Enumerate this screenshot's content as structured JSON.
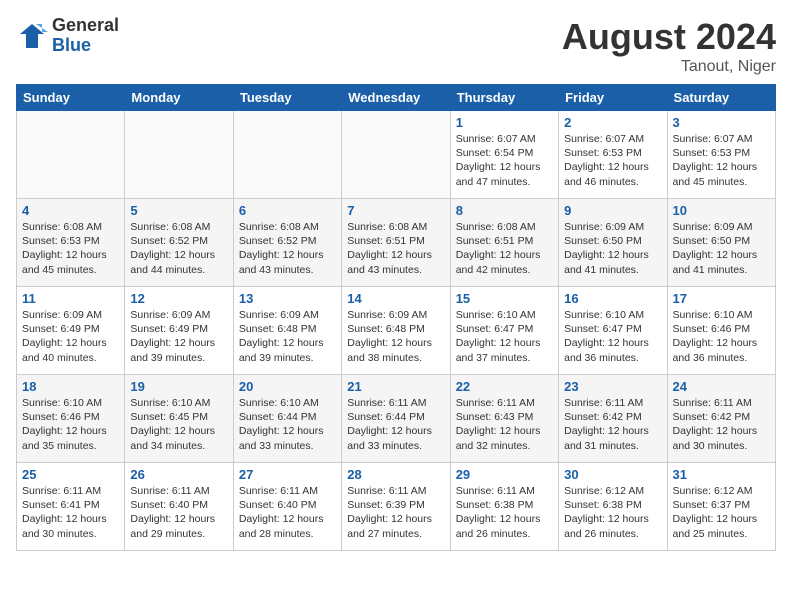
{
  "logo": {
    "general": "General",
    "blue": "Blue"
  },
  "title": {
    "month": "August 2024",
    "location": "Tanout, Niger"
  },
  "weekdays": [
    "Sunday",
    "Monday",
    "Tuesday",
    "Wednesday",
    "Thursday",
    "Friday",
    "Saturday"
  ],
  "weeks": [
    [
      {
        "day": "",
        "info": ""
      },
      {
        "day": "",
        "info": ""
      },
      {
        "day": "",
        "info": ""
      },
      {
        "day": "",
        "info": ""
      },
      {
        "day": "1",
        "info": "Sunrise: 6:07 AM\nSunset: 6:54 PM\nDaylight: 12 hours\nand 47 minutes."
      },
      {
        "day": "2",
        "info": "Sunrise: 6:07 AM\nSunset: 6:53 PM\nDaylight: 12 hours\nand 46 minutes."
      },
      {
        "day": "3",
        "info": "Sunrise: 6:07 AM\nSunset: 6:53 PM\nDaylight: 12 hours\nand 45 minutes."
      }
    ],
    [
      {
        "day": "4",
        "info": "Sunrise: 6:08 AM\nSunset: 6:53 PM\nDaylight: 12 hours\nand 45 minutes."
      },
      {
        "day": "5",
        "info": "Sunrise: 6:08 AM\nSunset: 6:52 PM\nDaylight: 12 hours\nand 44 minutes."
      },
      {
        "day": "6",
        "info": "Sunrise: 6:08 AM\nSunset: 6:52 PM\nDaylight: 12 hours\nand 43 minutes."
      },
      {
        "day": "7",
        "info": "Sunrise: 6:08 AM\nSunset: 6:51 PM\nDaylight: 12 hours\nand 43 minutes."
      },
      {
        "day": "8",
        "info": "Sunrise: 6:08 AM\nSunset: 6:51 PM\nDaylight: 12 hours\nand 42 minutes."
      },
      {
        "day": "9",
        "info": "Sunrise: 6:09 AM\nSunset: 6:50 PM\nDaylight: 12 hours\nand 41 minutes."
      },
      {
        "day": "10",
        "info": "Sunrise: 6:09 AM\nSunset: 6:50 PM\nDaylight: 12 hours\nand 41 minutes."
      }
    ],
    [
      {
        "day": "11",
        "info": "Sunrise: 6:09 AM\nSunset: 6:49 PM\nDaylight: 12 hours\nand 40 minutes."
      },
      {
        "day": "12",
        "info": "Sunrise: 6:09 AM\nSunset: 6:49 PM\nDaylight: 12 hours\nand 39 minutes."
      },
      {
        "day": "13",
        "info": "Sunrise: 6:09 AM\nSunset: 6:48 PM\nDaylight: 12 hours\nand 39 minutes."
      },
      {
        "day": "14",
        "info": "Sunrise: 6:09 AM\nSunset: 6:48 PM\nDaylight: 12 hours\nand 38 minutes."
      },
      {
        "day": "15",
        "info": "Sunrise: 6:10 AM\nSunset: 6:47 PM\nDaylight: 12 hours\nand 37 minutes."
      },
      {
        "day": "16",
        "info": "Sunrise: 6:10 AM\nSunset: 6:47 PM\nDaylight: 12 hours\nand 36 minutes."
      },
      {
        "day": "17",
        "info": "Sunrise: 6:10 AM\nSunset: 6:46 PM\nDaylight: 12 hours\nand 36 minutes."
      }
    ],
    [
      {
        "day": "18",
        "info": "Sunrise: 6:10 AM\nSunset: 6:46 PM\nDaylight: 12 hours\nand 35 minutes."
      },
      {
        "day": "19",
        "info": "Sunrise: 6:10 AM\nSunset: 6:45 PM\nDaylight: 12 hours\nand 34 minutes."
      },
      {
        "day": "20",
        "info": "Sunrise: 6:10 AM\nSunset: 6:44 PM\nDaylight: 12 hours\nand 33 minutes."
      },
      {
        "day": "21",
        "info": "Sunrise: 6:11 AM\nSunset: 6:44 PM\nDaylight: 12 hours\nand 33 minutes."
      },
      {
        "day": "22",
        "info": "Sunrise: 6:11 AM\nSunset: 6:43 PM\nDaylight: 12 hours\nand 32 minutes."
      },
      {
        "day": "23",
        "info": "Sunrise: 6:11 AM\nSunset: 6:42 PM\nDaylight: 12 hours\nand 31 minutes."
      },
      {
        "day": "24",
        "info": "Sunrise: 6:11 AM\nSunset: 6:42 PM\nDaylight: 12 hours\nand 30 minutes."
      }
    ],
    [
      {
        "day": "25",
        "info": "Sunrise: 6:11 AM\nSunset: 6:41 PM\nDaylight: 12 hours\nand 30 minutes."
      },
      {
        "day": "26",
        "info": "Sunrise: 6:11 AM\nSunset: 6:40 PM\nDaylight: 12 hours\nand 29 minutes."
      },
      {
        "day": "27",
        "info": "Sunrise: 6:11 AM\nSunset: 6:40 PM\nDaylight: 12 hours\nand 28 minutes."
      },
      {
        "day": "28",
        "info": "Sunrise: 6:11 AM\nSunset: 6:39 PM\nDaylight: 12 hours\nand 27 minutes."
      },
      {
        "day": "29",
        "info": "Sunrise: 6:11 AM\nSunset: 6:38 PM\nDaylight: 12 hours\nand 26 minutes."
      },
      {
        "day": "30",
        "info": "Sunrise: 6:12 AM\nSunset: 6:38 PM\nDaylight: 12 hours\nand 26 minutes."
      },
      {
        "day": "31",
        "info": "Sunrise: 6:12 AM\nSunset: 6:37 PM\nDaylight: 12 hours\nand 25 minutes."
      }
    ]
  ]
}
